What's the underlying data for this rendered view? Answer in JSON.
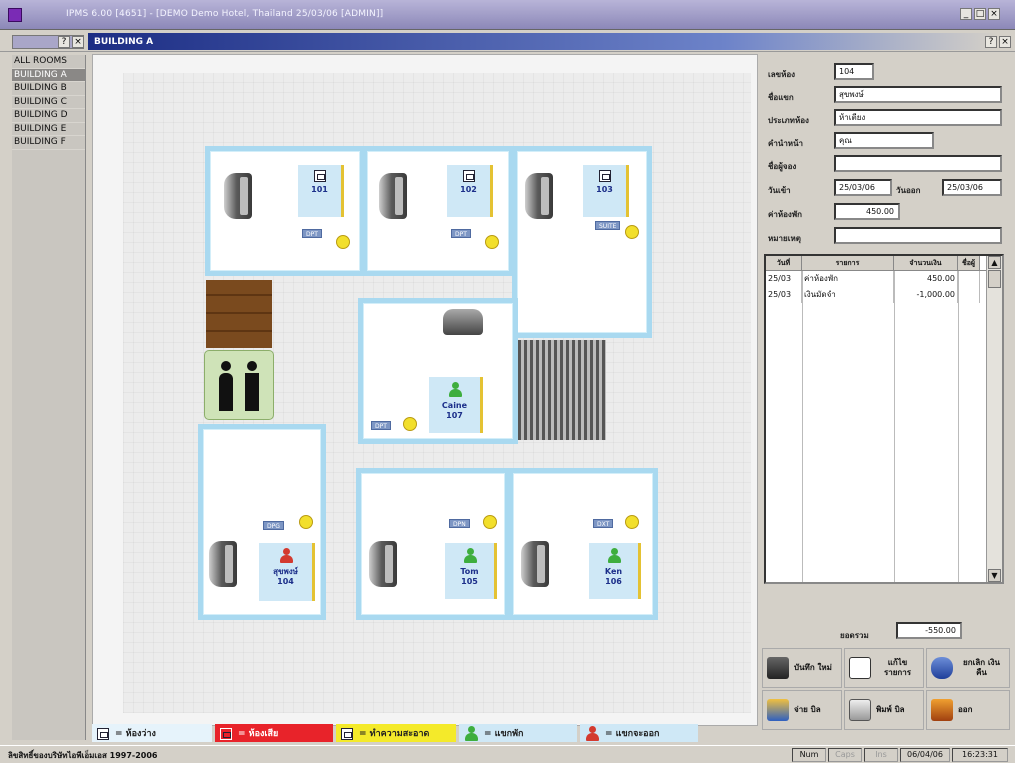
{
  "window": {
    "title": "IPMS 6.00 [4651] - [DEMO Demo Hotel, Thailand  25/03/06 [ADMIN]]",
    "sub_title": "BUILDING A"
  },
  "sidebar": {
    "items": [
      "ALL ROOMS",
      "BUILDING A",
      "BUILDING B",
      "BUILDING C",
      "BUILDING D",
      "BUILDING E",
      "BUILDING F"
    ],
    "selected": "BUILDING A"
  },
  "rooms": [
    {
      "number": "101",
      "guest": "",
      "tag": "DPT"
    },
    {
      "number": "102",
      "guest": "",
      "tag": "DPT"
    },
    {
      "number": "103",
      "guest": "",
      "tag": "SUITE"
    },
    {
      "number": "107",
      "guest": "Caine",
      "tag": "DPT"
    },
    {
      "number": "104",
      "guest": "สุขพงษ์",
      "tag": "DPG"
    },
    {
      "number": "105",
      "guest": "Tom",
      "tag": "DPN"
    },
    {
      "number": "106",
      "guest": "Ken",
      "tag": "DXT"
    }
  ],
  "legend": [
    {
      "label": "= ห้องว่าง",
      "color": "#cfe8f6"
    },
    {
      "label": "= ห้องเสีย",
      "color": "#e8232a"
    },
    {
      "label": "= ทำความสะอาด",
      "color": "#f4ea2a"
    },
    {
      "label": "= แขกพัก",
      "color": "#cfe8f6"
    },
    {
      "label": "= แขกจะออก",
      "color": "#cfe8f6"
    }
  ],
  "form": {
    "room_label": "เลขห้อง",
    "room_value": "104",
    "name_label": "ชื่อแขก",
    "name_value": "สุขพงษ์",
    "type_label": "ประเภทห้อง",
    "type_value": "ห้าเตียง",
    "title_label": "คำนำหน้า",
    "title_value": "คุณ",
    "agent_label": "ชื่อผู้จอง",
    "agent_value": "",
    "in_label": "วันเข้า",
    "in_value": "25/03/06",
    "out_label": "วันออก",
    "out_value": "25/03/06",
    "rate_label": "ค่าห้องพัก",
    "rate_value": "450.00",
    "note_label": "หมายเหตุ",
    "note_value": ""
  },
  "transactions": {
    "headers": [
      "วันที่",
      "รายการ",
      "จำนวนเงิน",
      "ชื่อผู้"
    ],
    "rows": [
      {
        "date": "25/03",
        "desc": "ค่าห้องพัก",
        "amount": "450.00"
      },
      {
        "date": "25/03",
        "desc": "เงินมัดจำ",
        "amount": "-1,000.00"
      }
    ]
  },
  "balance": {
    "label": "ยอดรวม",
    "value": "-550.00"
  },
  "actions": [
    {
      "label": "บันทึก ใหม่",
      "icon": "register-icon"
    },
    {
      "label": "แก้ไข รายการ",
      "icon": "document-icon"
    },
    {
      "label": "ยกเลิก เงินคืน",
      "icon": "mouse-icon"
    },
    {
      "label": "จ่าย บิล",
      "icon": "bill-icon"
    },
    {
      "label": "พิมพ์ บิล",
      "icon": "printer-icon"
    },
    {
      "label": "ออก",
      "icon": "exit-icon"
    }
  ],
  "status": {
    "copyright": "ลิขสิทธิ์ของบริษัทไอพีเอ็มเอส 1997-2006",
    "num": "Num",
    "caps": "Caps",
    "ins": "Ins",
    "date": "06/04/06",
    "time": "16:23:31"
  }
}
